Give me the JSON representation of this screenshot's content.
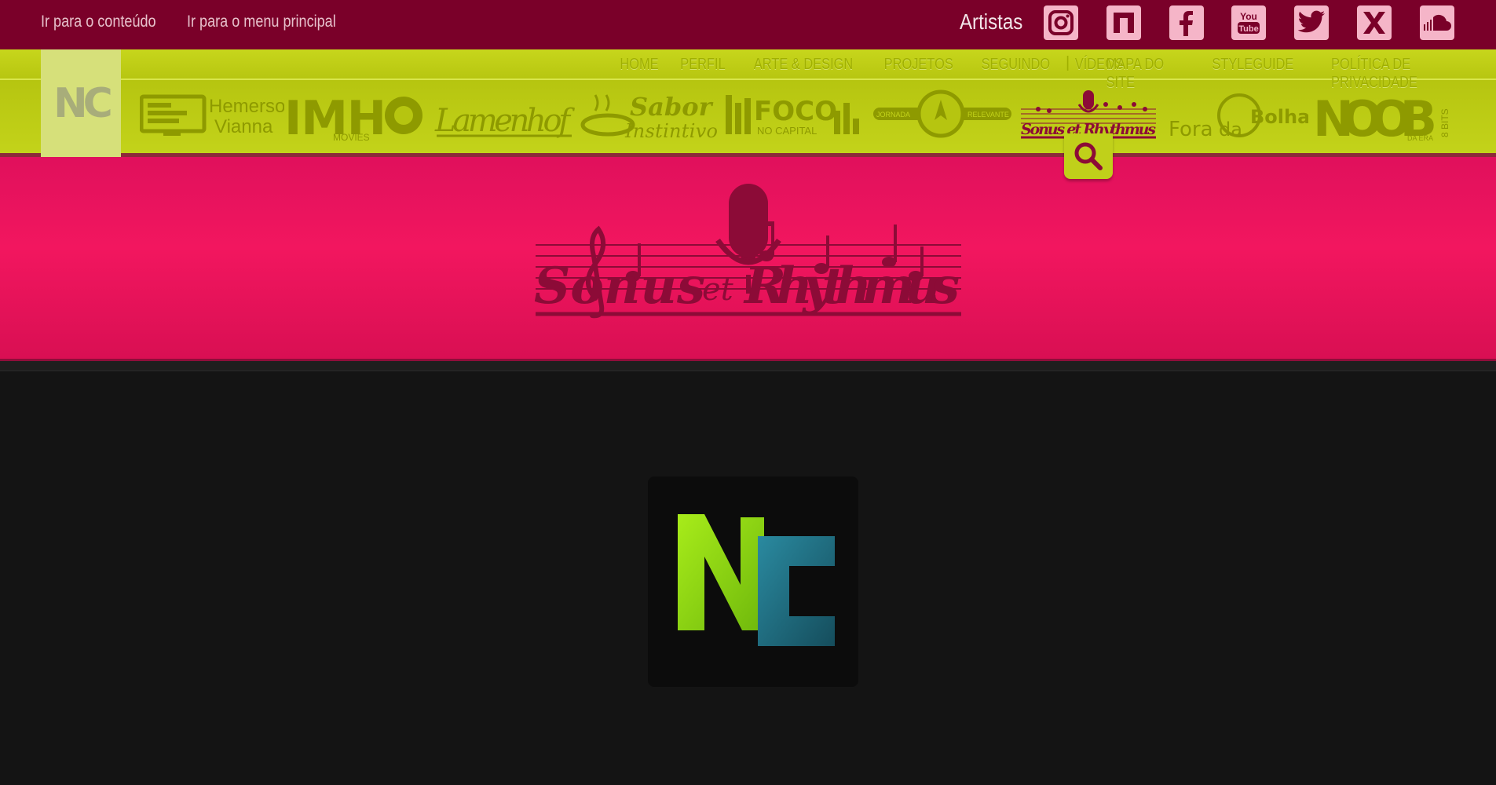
{
  "skip_links": {
    "content": "Ir para o conteúdo",
    "menu": "Ir para o menu principal"
  },
  "header": {
    "artists_label": "Artistas",
    "social": [
      {
        "name": "instagram-icon"
      },
      {
        "name": "behance-icon"
      },
      {
        "name": "facebook-icon"
      },
      {
        "name": "youtube-icon",
        "label": "You Tube"
      },
      {
        "name": "twitter-icon"
      },
      {
        "name": "xing-icon"
      },
      {
        "name": "soundcloud-icon"
      }
    ]
  },
  "nav": {
    "home_logo": "NC",
    "primary": [
      "HOME",
      "PERFIL",
      "ARTE & DESIGN",
      "PROJETOS",
      "SEGUINDO",
      "VÍDEOS"
    ],
    "separator": "|",
    "secondary": [
      "MAPA DO SITE",
      "STYLEGUIDE",
      "POLÍTICA DE PRIVACIDADE"
    ],
    "logos": {
      "hemerson_top": "Hemerson",
      "hemerson_bottom": "Vianna",
      "imh": "IMH",
      "imh_sub": "MOVIES",
      "lamenhof": "Lamenhof",
      "sabor_top": "Sabor",
      "sabor_bottom": "Instintivo",
      "foco": "FOCO",
      "foco_sub": "NO CAPITAL",
      "jornada_left": "JORNADA",
      "jornada_right": "RELEVANTE",
      "sonus": "Sonus et Rhythmus",
      "fora_left": "Fora",
      "fora_mid": "da",
      "fora_right": "Bolha",
      "noob": "NOOB",
      "noob_sub": "DA ERA",
      "noob_bits": "8 BITS"
    }
  },
  "banner": {
    "title_left": "Sonus",
    "title_mid": "et",
    "title_right": "Rhythmus"
  },
  "loader": {
    "letter_n": "N",
    "letter_c": "C"
  },
  "colors": {
    "topbar": "#7a0029",
    "nav": "#c0d01a",
    "banner": "#f2165f",
    "body": "#141414",
    "nc_green": "#8fd613",
    "nc_teal": "#1f6b80"
  }
}
